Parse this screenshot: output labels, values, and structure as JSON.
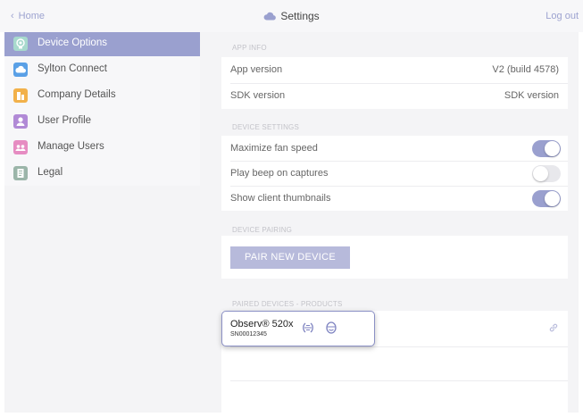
{
  "header": {
    "back_label": "Home",
    "title": "Settings",
    "logout_label": "Log out"
  },
  "sidebar": {
    "items": [
      {
        "label": "Device Options",
        "icon": "device-options-icon",
        "color": "#9ed2c6",
        "active": true
      },
      {
        "label": "Sylton Connect",
        "icon": "cloud-icon",
        "color": "#5aa0e6",
        "active": false
      },
      {
        "label": "Company Details",
        "icon": "company-icon",
        "color": "#f2b14a",
        "active": false
      },
      {
        "label": "User Profile",
        "icon": "user-icon",
        "color": "#b18ad6",
        "active": false
      },
      {
        "label": "Manage Users",
        "icon": "users-icon",
        "color": "#e68cc2",
        "active": false
      },
      {
        "label": "Legal",
        "icon": "document-icon",
        "color": "#9bb5a9",
        "active": false
      }
    ]
  },
  "app_info": {
    "header": "APP INFO",
    "rows": [
      {
        "label": "App version",
        "value": "V2 (build 4578)"
      },
      {
        "label": "SDK version",
        "value": "SDK version"
      }
    ]
  },
  "device_settings": {
    "header": "DEVICE SETTINGS",
    "rows": [
      {
        "label": "Maximize fan speed",
        "on": true
      },
      {
        "label": "Play beep on captures",
        "on": false
      },
      {
        "label": "Show client thumbnails",
        "on": true
      }
    ]
  },
  "device_pairing": {
    "header": "DEVICE PAIRING",
    "button_label": "PAIR NEW DEVICE"
  },
  "paired_devices": {
    "header": "PAIRED DEVICES - PRODUCTS",
    "device": {
      "name": "Observ® 520x",
      "serial": "SN00012345",
      "icons": [
        "face-scan-icon",
        "face-mask-icon"
      ]
    },
    "link_icon": "link-icon"
  },
  "colors": {
    "accent": "#9aa0cf",
    "link_text": "#9da3d0"
  }
}
